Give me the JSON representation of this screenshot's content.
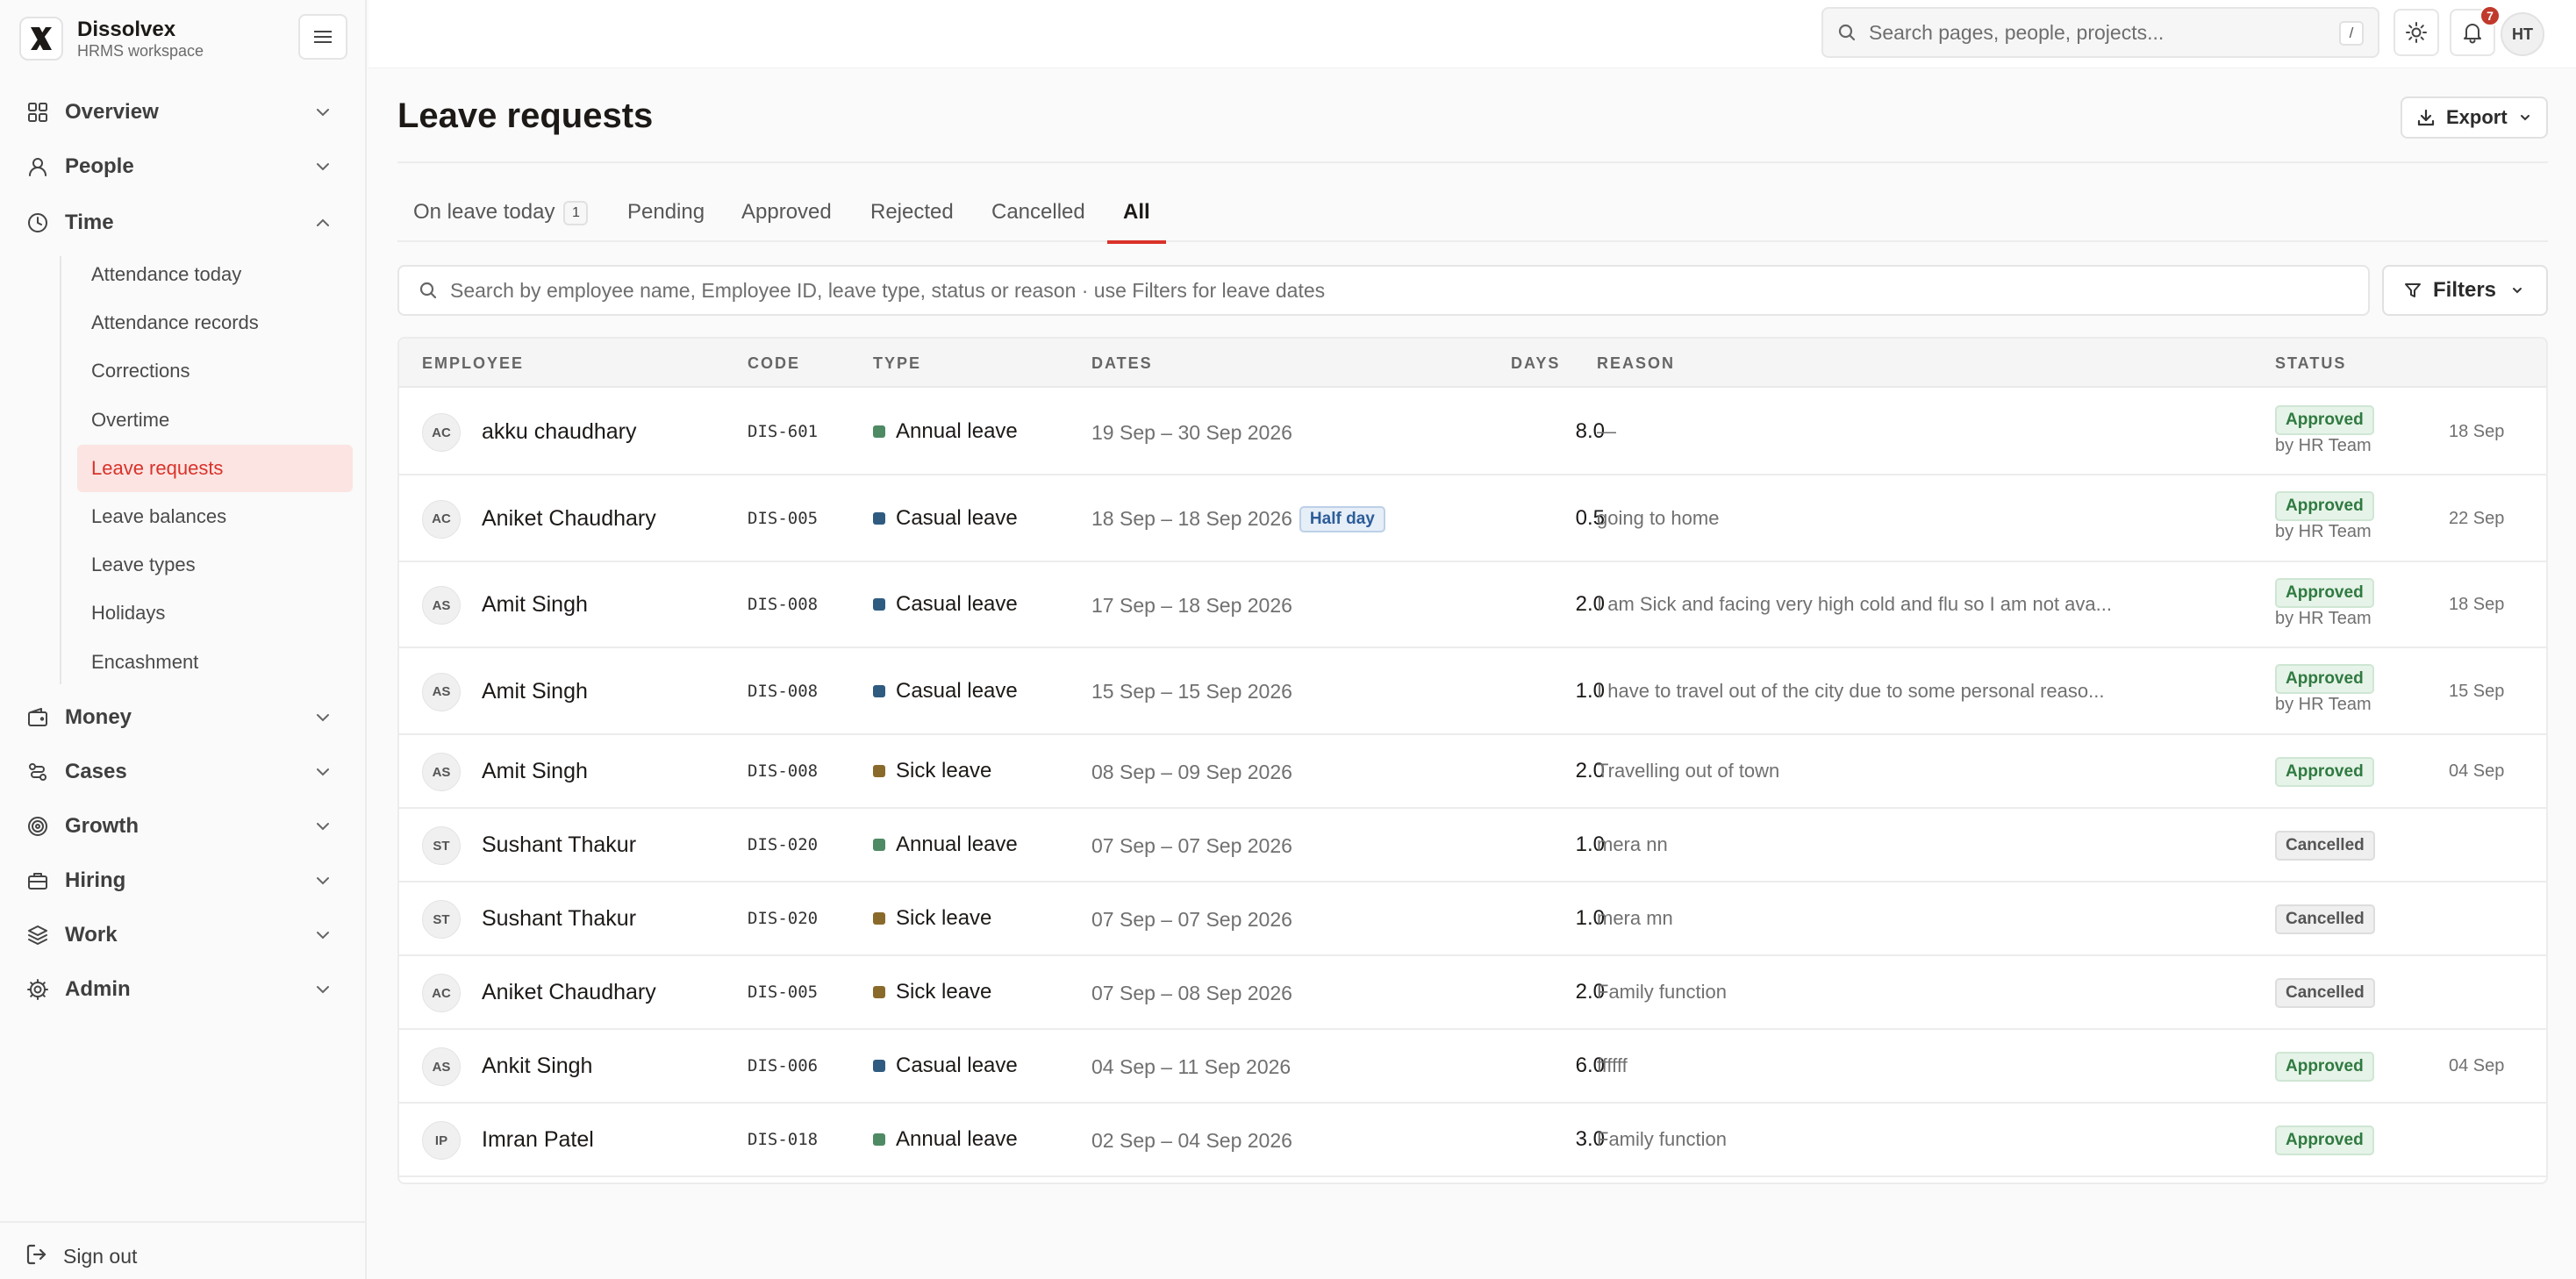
{
  "brand": {
    "name": "Dissolvex",
    "subtitle": "HRMS workspace"
  },
  "sidebar": {
    "groups": [
      {
        "label": "Overview",
        "icon": "grid-icon",
        "expanded": false
      },
      {
        "label": "People",
        "icon": "user-icon",
        "expanded": false
      },
      {
        "label": "Time",
        "icon": "clock-icon",
        "expanded": true
      },
      {
        "label": "Money",
        "icon": "wallet-icon",
        "expanded": false
      },
      {
        "label": "Cases",
        "icon": "cases-icon",
        "expanded": false
      },
      {
        "label": "Growth",
        "icon": "target-icon",
        "expanded": false
      },
      {
        "label": "Hiring",
        "icon": "briefcase-icon",
        "expanded": false
      },
      {
        "label": "Work",
        "icon": "layers-icon",
        "expanded": false
      },
      {
        "label": "Admin",
        "icon": "gear-icon",
        "expanded": false
      }
    ],
    "time_items": [
      "Attendance today",
      "Attendance records",
      "Corrections",
      "Overtime",
      "Leave requests",
      "Leave balances",
      "Leave types",
      "Holidays",
      "Encashment"
    ],
    "active_item": "Leave requests",
    "sign_out": "Sign out"
  },
  "topbar": {
    "search_placeholder": "Search pages, people, projects...",
    "search_shortcut": "/",
    "notification_count": "7",
    "user_initials": "HT"
  },
  "page": {
    "title": "Leave requests",
    "export_label": "Export",
    "tabs": [
      {
        "label": "On leave today",
        "count": "1"
      },
      {
        "label": "Pending"
      },
      {
        "label": "Approved"
      },
      {
        "label": "Rejected"
      },
      {
        "label": "Cancelled"
      },
      {
        "label": "All",
        "active": true
      }
    ],
    "search_placeholder": "Search by employee name, Employee ID, leave type, status or reason · use Filters for leave dates",
    "filters_label": "Filters"
  },
  "table": {
    "columns": [
      "EMPLOYEE",
      "CODE",
      "TYPE",
      "DATES",
      "DAYS",
      "REASON",
      "STATUS"
    ],
    "leave_colors": {
      "Annual leave": "#4e8a63",
      "Casual leave": "#2f5b80",
      "Sick leave": "#8a6a2a"
    },
    "rows": [
      {
        "initials": "AC",
        "name": "akku chaudhary",
        "code": "DIS-601",
        "type": "Annual leave",
        "dates": "19 Sep – 30 Sep 2026",
        "half_day": "",
        "days": "8.0",
        "reason": "—",
        "status": "Approved",
        "by": "by HR Team",
        "date": "18 Sep"
      },
      {
        "initials": "AC",
        "name": "Aniket Chaudhary",
        "code": "DIS-005",
        "type": "Casual leave",
        "dates": "18 Sep – 18 Sep 2026",
        "half_day": "Half day",
        "days": "0.5",
        "reason": "going to home",
        "status": "Approved",
        "by": "by HR Team",
        "date": "22 Sep"
      },
      {
        "initials": "AS",
        "name": "Amit Singh",
        "code": "DIS-008",
        "type": "Casual leave",
        "dates": "17 Sep – 18 Sep 2026",
        "half_day": "",
        "days": "2.0",
        "reason": "I am Sick and facing very high cold and flu so I am not ava...",
        "status": "Approved",
        "by": "by HR Team",
        "date": "18 Sep"
      },
      {
        "initials": "AS",
        "name": "Amit Singh",
        "code": "DIS-008",
        "type": "Casual leave",
        "dates": "15 Sep – 15 Sep 2026",
        "half_day": "",
        "days": "1.0",
        "reason": "I have to travel out of the city due to some personal reaso...",
        "status": "Approved",
        "by": "by HR Team",
        "date": "15 Sep"
      },
      {
        "initials": "AS",
        "name": "Amit Singh",
        "code": "DIS-008",
        "type": "Sick leave",
        "dates": "08 Sep – 09 Sep 2026",
        "half_day": "",
        "days": "2.0",
        "reason": "Travelling out of town",
        "status": "Approved",
        "by": "",
        "date": "04 Sep"
      },
      {
        "initials": "ST",
        "name": "Sushant Thakur",
        "code": "DIS-020",
        "type": "Annual leave",
        "dates": "07 Sep – 07 Sep 2026",
        "half_day": "",
        "days": "1.0",
        "reason": "mera nn",
        "status": "Cancelled",
        "by": "",
        "date": ""
      },
      {
        "initials": "ST",
        "name": "Sushant Thakur",
        "code": "DIS-020",
        "type": "Sick leave",
        "dates": "07 Sep – 07 Sep 2026",
        "half_day": "",
        "days": "1.0",
        "reason": "mera mn",
        "status": "Cancelled",
        "by": "",
        "date": ""
      },
      {
        "initials": "AC",
        "name": "Aniket Chaudhary",
        "code": "DIS-005",
        "type": "Sick leave",
        "dates": "07 Sep – 08 Sep 2026",
        "half_day": "",
        "days": "2.0",
        "reason": "Family function",
        "status": "Cancelled",
        "by": "",
        "date": ""
      },
      {
        "initials": "AS",
        "name": "Ankit Singh",
        "code": "DIS-006",
        "type": "Casual leave",
        "dates": "04 Sep – 11 Sep 2026",
        "half_day": "",
        "days": "6.0",
        "reason": "ffffff",
        "status": "Approved",
        "by": "",
        "date": "04 Sep"
      },
      {
        "initials": "IP",
        "name": "Imran Patel",
        "code": "DIS-018",
        "type": "Annual leave",
        "dates": "02 Sep – 04 Sep 2026",
        "half_day": "",
        "days": "3.0",
        "reason": "Family function",
        "status": "Approved",
        "by": "",
        "date": ""
      }
    ]
  },
  "colors": {
    "accent": "#d9322a",
    "approved": "#2f7a40",
    "half_day": "#2c5d99"
  }
}
